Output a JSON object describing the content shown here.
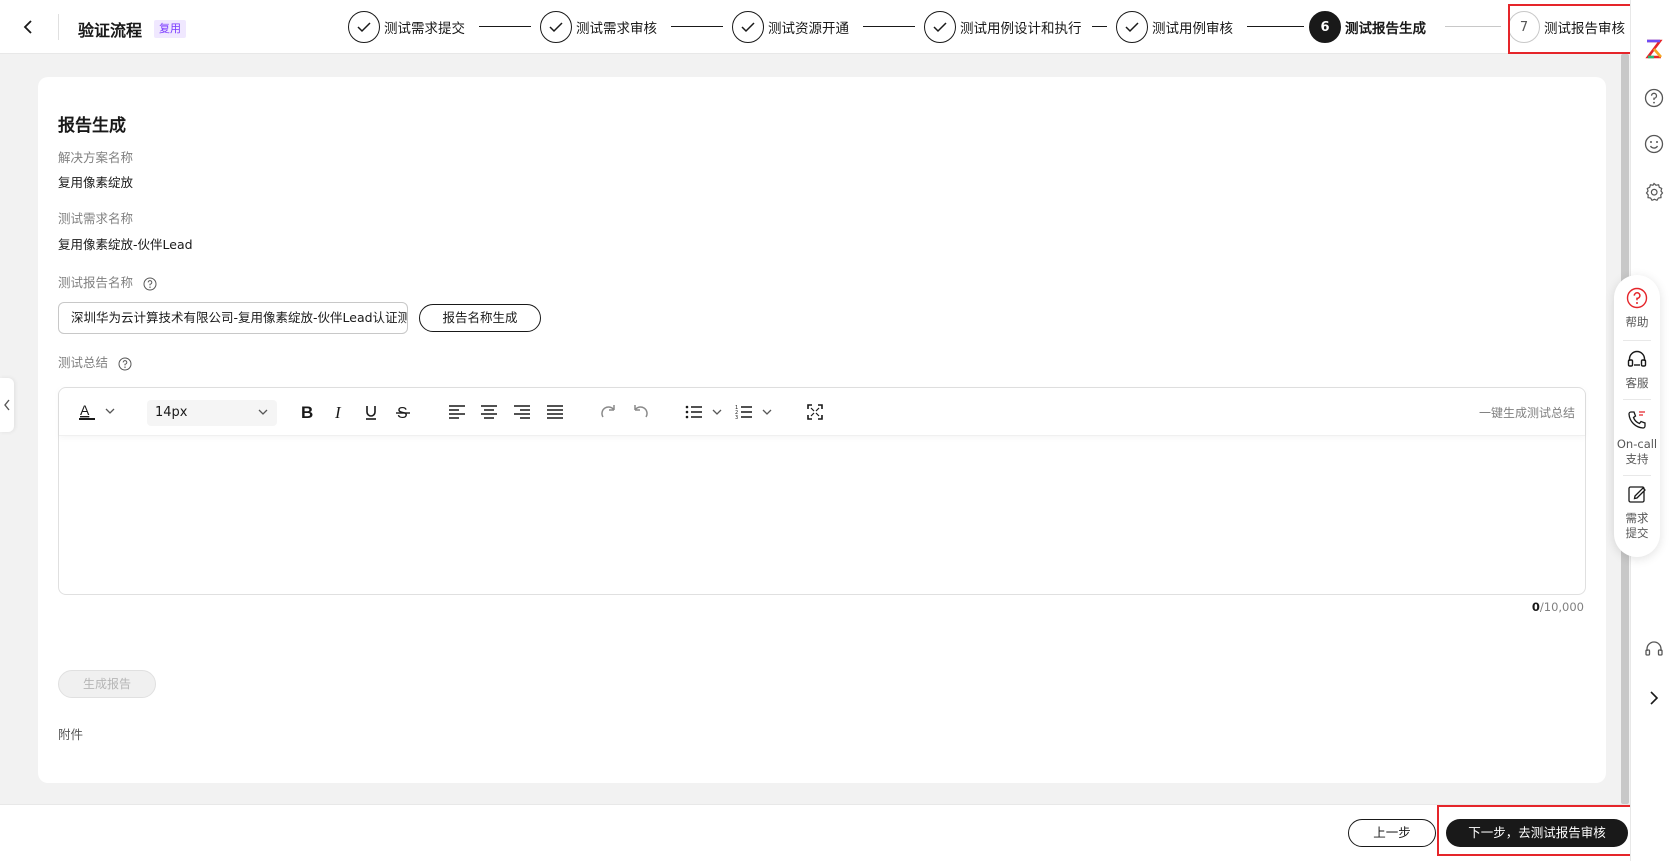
{
  "header": {
    "title": "验证流程",
    "badge": "复用",
    "steps": [
      {
        "index": "1",
        "label": "测试需求提交",
        "status": "done"
      },
      {
        "index": "2",
        "label": "测试需求审核",
        "status": "done"
      },
      {
        "index": "3",
        "label": "测试资源开通",
        "status": "done"
      },
      {
        "index": "4",
        "label": "测试用例设计和执行",
        "status": "done"
      },
      {
        "index": "5",
        "label": "测试用例审核",
        "status": "done"
      },
      {
        "index": "6",
        "label": "测试报告生成",
        "status": "current"
      },
      {
        "index": "7",
        "label": "测试报告审核",
        "status": "pending"
      }
    ]
  },
  "form": {
    "section_title": "报告生成",
    "solution_name_label": "解决方案名称",
    "solution_name_value": "复用像素绽放",
    "requirement_name_label": "测试需求名称",
    "requirement_name_value": "复用像素绽放-伙伴Lead",
    "report_name_label": "测试报告名称",
    "report_name_value": "深圳华为云计算技术有限公司-复用像素绽放-伙伴Lead认证测",
    "generate_name_button": "报告名称生成",
    "summary_label": "测试总结",
    "editor": {
      "font_size": "14px",
      "ai_summary": "一键生成测试总结",
      "char_count_current": "0",
      "char_count_max": "/10,000"
    },
    "generate_report_button": "生成报告",
    "attachment_label": "附件"
  },
  "float_panel": {
    "help": "帮助",
    "service": "客服",
    "oncall_1": "On-call",
    "oncall_2": "支持",
    "req_1": "需求",
    "req_2": "提交"
  },
  "footer": {
    "prev_button": "上一步",
    "next_button": "下一步，去测试报告审核"
  },
  "colors": {
    "accent": "#191919",
    "badge_text": "#7a39ff",
    "highlight_box": "#e5252a"
  }
}
